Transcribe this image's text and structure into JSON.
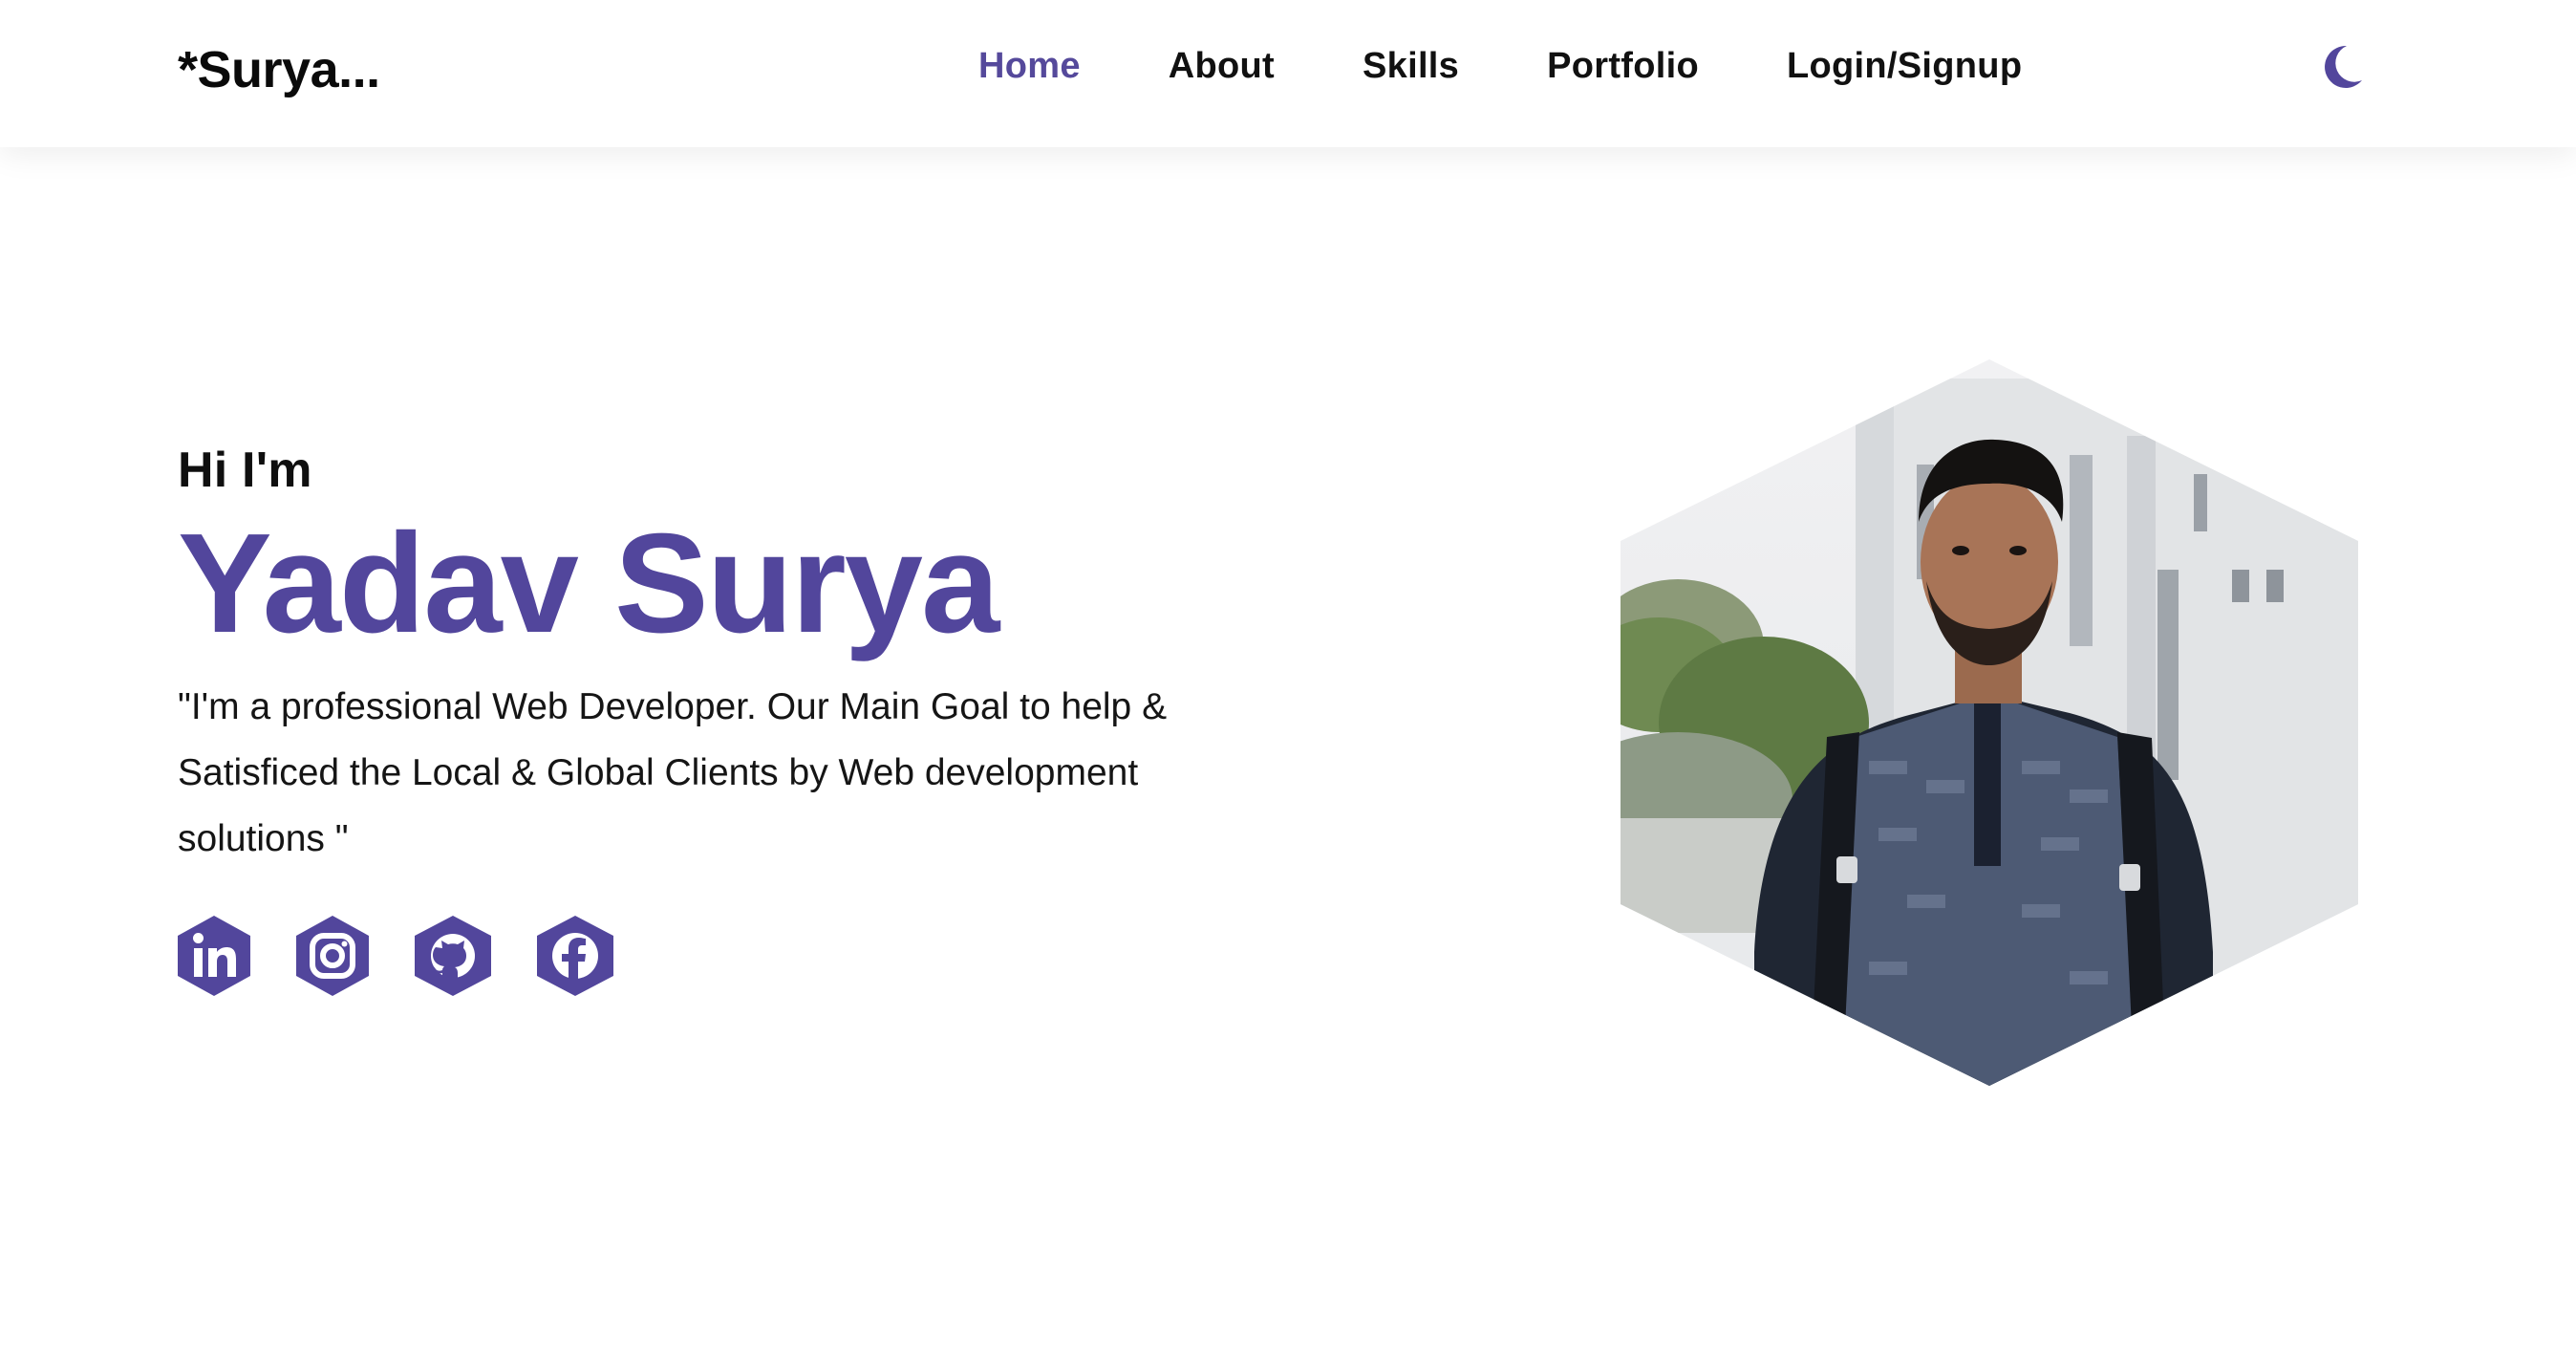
{
  "header": {
    "logo": "*Surya...",
    "nav": [
      {
        "label": "Home",
        "active": true
      },
      {
        "label": "About",
        "active": false
      },
      {
        "label": "Skills",
        "active": false
      },
      {
        "label": "Portfolio",
        "active": false
      },
      {
        "label": "Login/Signup",
        "active": false
      }
    ],
    "theme_toggle_icon": "moon-icon"
  },
  "hero": {
    "greeting": "Hi I'm",
    "name": "Yadav Surya",
    "tagline": "\"I'm a professional Web Developer. Our Main Goal to help & Satisficed the Local & Global Clients by Web development solutions \"",
    "social_icons": [
      "linkedin-icon",
      "instagram-icon",
      "github-icon",
      "facebook-icon"
    ],
    "portrait_image": "profile-photo"
  },
  "colors": {
    "accent": "#52469c",
    "text": "#111111",
    "background": "#ffffff"
  }
}
